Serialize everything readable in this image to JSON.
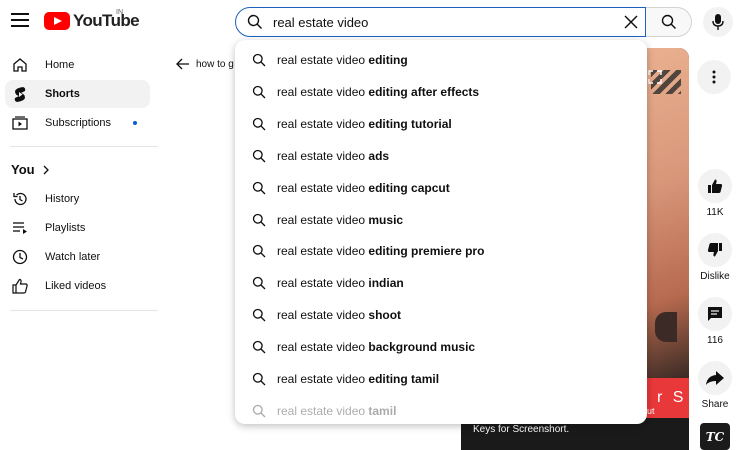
{
  "header": {
    "logo_text": "YouTube",
    "country_code": "IN",
    "search_value": "real estate video"
  },
  "sidebar": {
    "items": [
      {
        "label": "Home",
        "icon": "home-icon"
      },
      {
        "label": "Shorts",
        "icon": "shorts-icon"
      },
      {
        "label": "Subscriptions",
        "icon": "subscriptions-icon"
      }
    ],
    "you_heading": "You",
    "you_items": [
      {
        "label": "History",
        "icon": "history-icon"
      },
      {
        "label": "Playlists",
        "icon": "playlists-icon"
      },
      {
        "label": "Watch later",
        "icon": "watch-later-icon"
      },
      {
        "label": "Liked videos",
        "icon": "liked-videos-icon"
      }
    ]
  },
  "content": {
    "back_label": "how to g"
  },
  "video": {
    "banner_text": "r S",
    "banner_sub": "ut",
    "caption": "Keys for Screenshort."
  },
  "actions": {
    "like_count": "11K",
    "dislike_label": "Dislike",
    "comments_count": "116",
    "share_label": "Share",
    "channel_initials": "TC"
  },
  "suggestions": [
    {
      "prefix": "real estate video ",
      "bold": "editing"
    },
    {
      "prefix": "real estate video ",
      "bold": "editing after effects"
    },
    {
      "prefix": "real estate video ",
      "bold": "editing tutorial"
    },
    {
      "prefix": "real estate video ",
      "bold": "ads"
    },
    {
      "prefix": "real estate video ",
      "bold": "editing capcut"
    },
    {
      "prefix": "real estate video ",
      "bold": "music"
    },
    {
      "prefix": "real estate video ",
      "bold": "editing premiere pro"
    },
    {
      "prefix": "real estate video ",
      "bold": "indian"
    },
    {
      "prefix": "real estate video ",
      "bold": "shoot"
    },
    {
      "prefix": "real estate video ",
      "bold": "background music"
    },
    {
      "prefix": "real estate video ",
      "bold": "editing tamil"
    },
    {
      "prefix": "real estate video ",
      "bold": "tamil"
    }
  ],
  "colors": {
    "brand_red": "#ff0000",
    "focus_blue": "#1c62b9",
    "active_bg": "#f2f2f2"
  }
}
